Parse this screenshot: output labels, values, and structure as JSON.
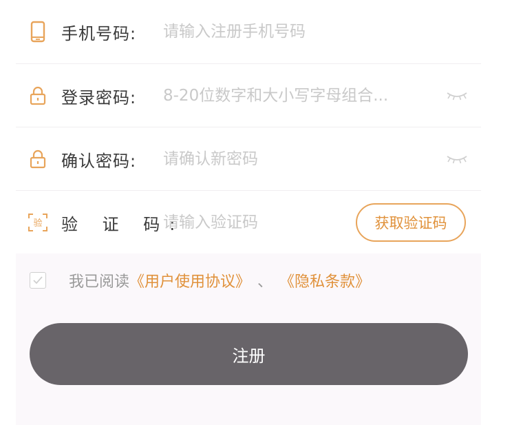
{
  "form": {
    "phone": {
      "icon": "phone-icon",
      "label": "手机号码:",
      "placeholder": "请输入注册手机号码"
    },
    "password": {
      "icon": "lock-icon",
      "label": "登录密码:",
      "placeholder": "8-20位数字和大小写字母组合...",
      "toggle_icon": "eye-closed-icon"
    },
    "confirm_password": {
      "icon": "lock-icon",
      "label": "确认密码:",
      "placeholder": "请确认新密码",
      "toggle_icon": "eye-closed-icon"
    },
    "verification_code": {
      "icon": "verify-code-icon",
      "label": "验 证 码:",
      "placeholder": "请输入验证码",
      "button_label": "获取验证码"
    }
  },
  "agreement": {
    "checked": false,
    "prefix": "我已阅读",
    "user_agreement_link": "《用户使用协议》",
    "separator": "、",
    "privacy_link": "《隐私条款》"
  },
  "register_button": {
    "label": "注册"
  },
  "colors": {
    "accent": "#e0913a",
    "button": "#686469",
    "placeholder": "#c9c9c9",
    "background": "#fbf8fb"
  }
}
